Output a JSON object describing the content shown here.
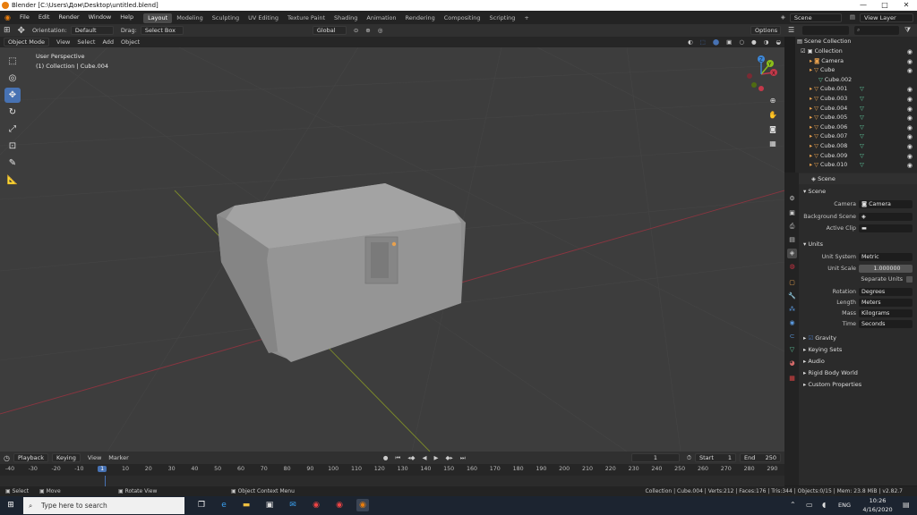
{
  "title_bar": {
    "title": "Blender [C:\\Users\\Дом\\Desktop\\untitled.blend]",
    "minimize": "—",
    "maximize": "□",
    "close": "✕"
  },
  "menu": [
    "File",
    "Edit",
    "Render",
    "Window",
    "Help"
  ],
  "workspaces": [
    "Layout",
    "Modeling",
    "Sculpting",
    "UV Editing",
    "Texture Paint",
    "Shading",
    "Animation",
    "Rendering",
    "Compositing",
    "Scripting",
    "+"
  ],
  "scene": {
    "scene_name": "Scene",
    "view_layer": "View Layer"
  },
  "header": {
    "orientation_label": "Orientation:",
    "orientation_value": "Default",
    "drag_label": "Drag:",
    "drag_value": "Select Box",
    "transform_value": "Global",
    "options": "Options"
  },
  "viewport_header": {
    "mode": "Object Mode",
    "menus": [
      "View",
      "Select",
      "Add",
      "Object"
    ]
  },
  "viewport": {
    "perspective": "User Perspective",
    "collection_info": "(1) Collection | Cube.004"
  },
  "tools": [
    "select-box",
    "cursor",
    "move",
    "rotate",
    "scale",
    "transform",
    "annotate",
    "measure"
  ],
  "gizmo": {
    "x": "X",
    "y": "Y",
    "z": "Z"
  },
  "outliner": {
    "header": "Scene Collection",
    "items": [
      {
        "name": "Collection",
        "indent": 0,
        "type": "collection"
      },
      {
        "name": "Camera",
        "indent": 1,
        "type": "camera"
      },
      {
        "name": "Cube",
        "indent": 1,
        "type": "mesh"
      },
      {
        "name": "Cube.002",
        "indent": 2,
        "type": "mesh-data"
      },
      {
        "name": "Cube.001",
        "indent": 1,
        "type": "mesh"
      },
      {
        "name": "Cube.003",
        "indent": 1,
        "type": "mesh"
      },
      {
        "name": "Cube.004",
        "indent": 1,
        "type": "mesh"
      },
      {
        "name": "Cube.005",
        "indent": 1,
        "type": "mesh"
      },
      {
        "name": "Cube.006",
        "indent": 1,
        "type": "mesh"
      },
      {
        "name": "Cube.007",
        "indent": 1,
        "type": "mesh"
      },
      {
        "name": "Cube.008",
        "indent": 1,
        "type": "mesh"
      },
      {
        "name": "Cube.009",
        "indent": 1,
        "type": "mesh"
      },
      {
        "name": "Cube.010",
        "indent": 1,
        "type": "mesh"
      }
    ]
  },
  "properties": {
    "header": "Scene",
    "scene_section": "Scene",
    "camera_label": "Camera",
    "camera_value": "Camera",
    "bg_scene_label": "Background Scene",
    "active_clip_label": "Active Clip",
    "units_section": "Units",
    "unit_system_label": "Unit System",
    "unit_system_value": "Metric",
    "unit_scale_label": "Unit Scale",
    "unit_scale_value": "1.000000",
    "separate_units_label": "Separate Units",
    "rotation_label": "Rotation",
    "rotation_value": "Degrees",
    "length_label": "Length",
    "length_value": "Meters",
    "mass_label": "Mass",
    "mass_value": "Kilograms",
    "time_label": "Time",
    "time_value": "Seconds",
    "gravity": "Gravity",
    "keying_sets": "Keying Sets",
    "audio": "Audio",
    "rigid_body": "Rigid Body World",
    "custom_props": "Custom Properties"
  },
  "timeline": {
    "menus": [
      "Playback",
      "Keying",
      "View",
      "Marker"
    ],
    "current_frame": "1",
    "start_label": "Start",
    "start": "1",
    "end_label": "End",
    "end": "250",
    "ticks": [
      "-40",
      "-30",
      "-20",
      "-10",
      "1",
      "10",
      "20",
      "30",
      "40",
      "50",
      "60",
      "70",
      "80",
      "90",
      "100",
      "110",
      "120",
      "130",
      "140",
      "150",
      "160",
      "170",
      "180",
      "190",
      "200",
      "210",
      "220",
      "230",
      "240",
      "250",
      "260",
      "270",
      "280",
      "290"
    ]
  },
  "status_bar": {
    "select": "Select",
    "move": "Move",
    "rotate_view": "Rotate View",
    "context_menu": "Object Context Menu",
    "stats": "Collection | Cube.004 | Verts:212 | Faces:176 | Tris:344 | Objects:0/15 | Mem: 23.8 MiB | v2.82.7"
  },
  "taskbar": {
    "search": "Type here to search",
    "lang": "ENG",
    "time": "10:26",
    "date": "4/16/2020"
  },
  "colors": {
    "accent": "#4772b3",
    "x_axis": "#c3394a",
    "y_axis": "#8cbf1b",
    "z_axis": "#3e88d8",
    "object_orange": "#e8a14e"
  }
}
